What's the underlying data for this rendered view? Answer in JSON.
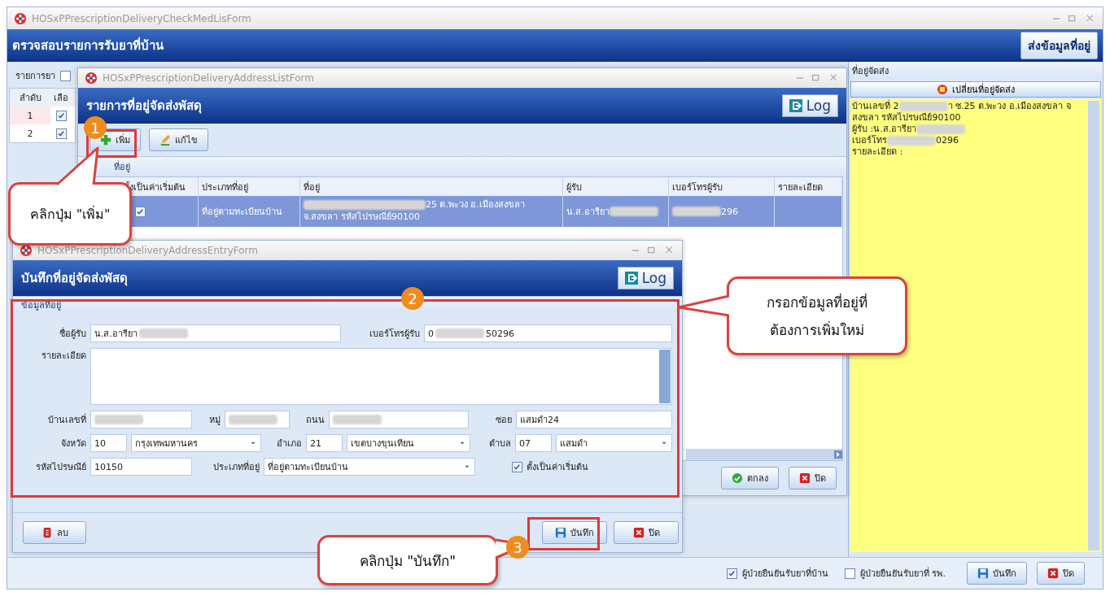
{
  "main_window": {
    "title": "HOSxPPrescriptionDeliveryCheckMedLisForm",
    "header": "ตรวจสอบรายการรับยาที่บ้าน",
    "send_button": "ส่งข้อมูลที่อยู่",
    "drug_panel": {
      "label": "รายการยา",
      "select_all_checked": false,
      "columns": [
        "ลำดับ",
        "เลือ"
      ],
      "rows": [
        {
          "number": "1",
          "checked": true,
          "selected": true
        },
        {
          "number": "2",
          "checked": true,
          "selected": false
        }
      ]
    },
    "address_panel": {
      "label": "ที่อยู่จัดส่ง",
      "change_button": "เปลี่ยนที่อยู่จัดส่ง",
      "lines": [
        [
          {
            "kind": "text",
            "text": "บ้านเลขที่ 2"
          },
          {
            "kind": "blur"
          },
          {
            "kind": "text",
            "text": "า ซ.25 ต.พะวง อ.เมืองสงขลา จ"
          }
        ],
        [
          {
            "kind": "text",
            "text": "สงขลา รหัสไปรษณีย์90100"
          }
        ],
        [
          {
            "kind": "text",
            "text": "ผู้รับ :น.ส.อารียา"
          },
          {
            "kind": "blur"
          }
        ],
        [
          {
            "kind": "text",
            "text": "เบอร์โทร"
          },
          {
            "kind": "blur"
          },
          {
            "kind": "text",
            "text": "0296"
          }
        ],
        [
          {
            "kind": "text",
            "text": "รายละเอียด :"
          }
        ]
      ]
    },
    "footer": {
      "checkboxes": [
        {
          "label": "ผู้ป่วยยืนยันรับยาที่บ้าน",
          "checked": true
        },
        {
          "label": "ผู้ป่วยยืนยันรับยาที่ รพ.",
          "checked": false
        }
      ],
      "buttons": [
        {
          "kind": "save",
          "label": "บันทึก"
        },
        {
          "kind": "close",
          "label": "ปิด"
        }
      ]
    }
  },
  "address_list_window": {
    "title": "HOSxPPrescriptionDeliveryAddressListForm",
    "header": "รายการที่อยู่จัดส่งพัสดุ",
    "log_button": "Log",
    "toolbar": [
      {
        "kind": "add",
        "label": "เพิ่ม"
      },
      {
        "kind": "edit",
        "label": "แก้ไข"
      }
    ],
    "group_label": "ที่อยู่",
    "columns": [
      "ั้งเป็นค่าเริ่มต้น",
      "ประเภทที่อยู่",
      "ที่อยู่",
      "ผู้รับ",
      "เบอร์โทรผู้รับ",
      "รายละเอียด"
    ],
    "rows": [
      {
        "selected": true,
        "is_default": true,
        "address_type": "ที่อยู่ตามทะเบียนบ้าน",
        "address": [
          {
            "kind": "blur"
          },
          {
            "kind": "text",
            "text": "25 ต.พะวง อ.เมืองสงขลา"
          },
          {
            "kind": "break"
          },
          {
            "kind": "text",
            "text": "จ.สงขลา รหัสไปรษณีย์90100"
          }
        ],
        "recipient": [
          {
            "kind": "text",
            "text": "น.ส.อารียา"
          },
          {
            "kind": "blur"
          }
        ],
        "phone": [
          {
            "kind": "blur"
          },
          {
            "kind": "text",
            "text": "296"
          }
        ]
      }
    ],
    "buttons": [
      {
        "kind": "ok",
        "label": "ตกลง"
      },
      {
        "kind": "close",
        "label": "ปิด"
      }
    ]
  },
  "address_entry_window": {
    "title": "HOSxPPrescriptionDeliveryAddressEntryForm",
    "header": "บันทึกที่อยู่จัดส่งพัสดุ",
    "log_button": "Log",
    "group_label": "ข้อมูลที่อยู่",
    "form_lines": [
      [
        {
          "kind": "text",
          "label": "ชื่อผู้รับ",
          "parts": [
            {
              "kind": "text",
              "text": "น.ส.อารียา"
            },
            {
              "kind": "blur"
            }
          ]
        },
        {
          "kind": "text",
          "label": "เบอร์โทรผู้รับ",
          "parts": [
            {
              "kind": "text",
              "text": "0"
            },
            {
              "kind": "blur"
            },
            {
              "kind": "text",
              "text": "50296"
            }
          ]
        }
      ],
      [
        {
          "kind": "memo",
          "label": "รายละเอียด"
        }
      ],
      [
        {
          "kind": "text",
          "label": "บ้านเลขที่",
          "parts": [
            {
              "kind": "blur"
            }
          ]
        },
        {
          "kind": "text",
          "label": "หมู่",
          "parts": [
            {
              "kind": "blur"
            }
          ]
        },
        {
          "kind": "text",
          "label": "ถนน",
          "parts": [
            {
              "kind": "blur"
            }
          ]
        },
        {
          "kind": "text",
          "label": "ซอย",
          "parts": [
            {
              "kind": "text",
              "text": "แสมดำ24"
            }
          ]
        }
      ],
      [
        {
          "kind": "code_combo",
          "label": "จังหวัด",
          "code": "10",
          "value": "กรุงเทพมหานคร"
        },
        {
          "kind": "code_combo",
          "label": "อำเภอ",
          "code": "21",
          "value": "เขตบางขุนเทียน"
        },
        {
          "kind": "code_combo",
          "label": "ตำบล",
          "code": "07",
          "value": "แสมดำ"
        }
      ],
      [
        {
          "kind": "text",
          "label": "รหัสไปรษณีย์",
          "parts": [
            {
              "kind": "text",
              "text": "10150"
            }
          ]
        },
        {
          "kind": "combo",
          "label": "ประเภทที่อยู่",
          "value": "ที่อยู่ตามทะเบียนบ้าน"
        },
        {
          "kind": "check",
          "label": "ตั้งเป็นค่าเริ่มต้น",
          "checked": true
        }
      ]
    ],
    "buttons": [
      {
        "kind": "delete",
        "label": "ลบ"
      },
      {
        "kind": "save",
        "label": "บันทึก"
      },
      {
        "kind": "close",
        "label": "ปิด"
      }
    ]
  },
  "callouts": [
    {
      "number": "1",
      "text": "คลิกปุ่ม \"เพิ่ม\""
    },
    {
      "number": "2",
      "text": "กรอกข้อมูลที่อยู่ที่ต้องการเพิ่มใหม่"
    },
    {
      "number": "3",
      "text": "คลิกปุ่ม \"บันทึก\""
    }
  ]
}
